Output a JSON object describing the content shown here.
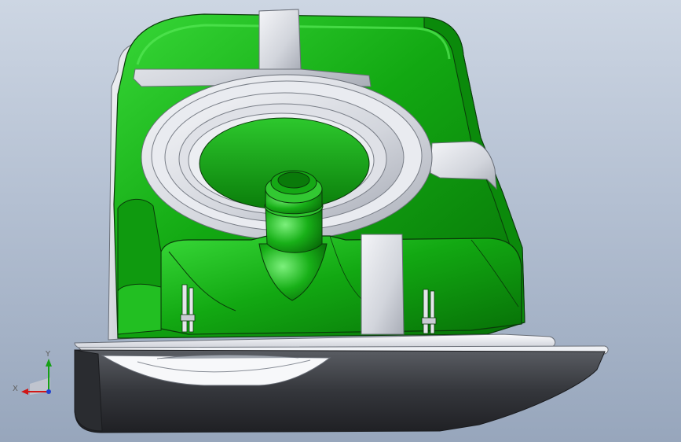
{
  "viewport": {
    "background_top": "#cdd6e3",
    "background_bottom": "#97a6bc"
  },
  "model": {
    "selected_face_color": "#10a010",
    "highlight_color": "#3ee03e",
    "shadow_color": "#086608",
    "unselected_face_color": "#d8dbe2",
    "base_color": "#3c3f45",
    "edge_color": "#0a3a0a"
  },
  "triad": {
    "x_label": "X",
    "y_label": "Y",
    "x_color": "#d01818",
    "y_color": "#16a016",
    "z_color": "#2040d0",
    "label_color": "#606060"
  }
}
